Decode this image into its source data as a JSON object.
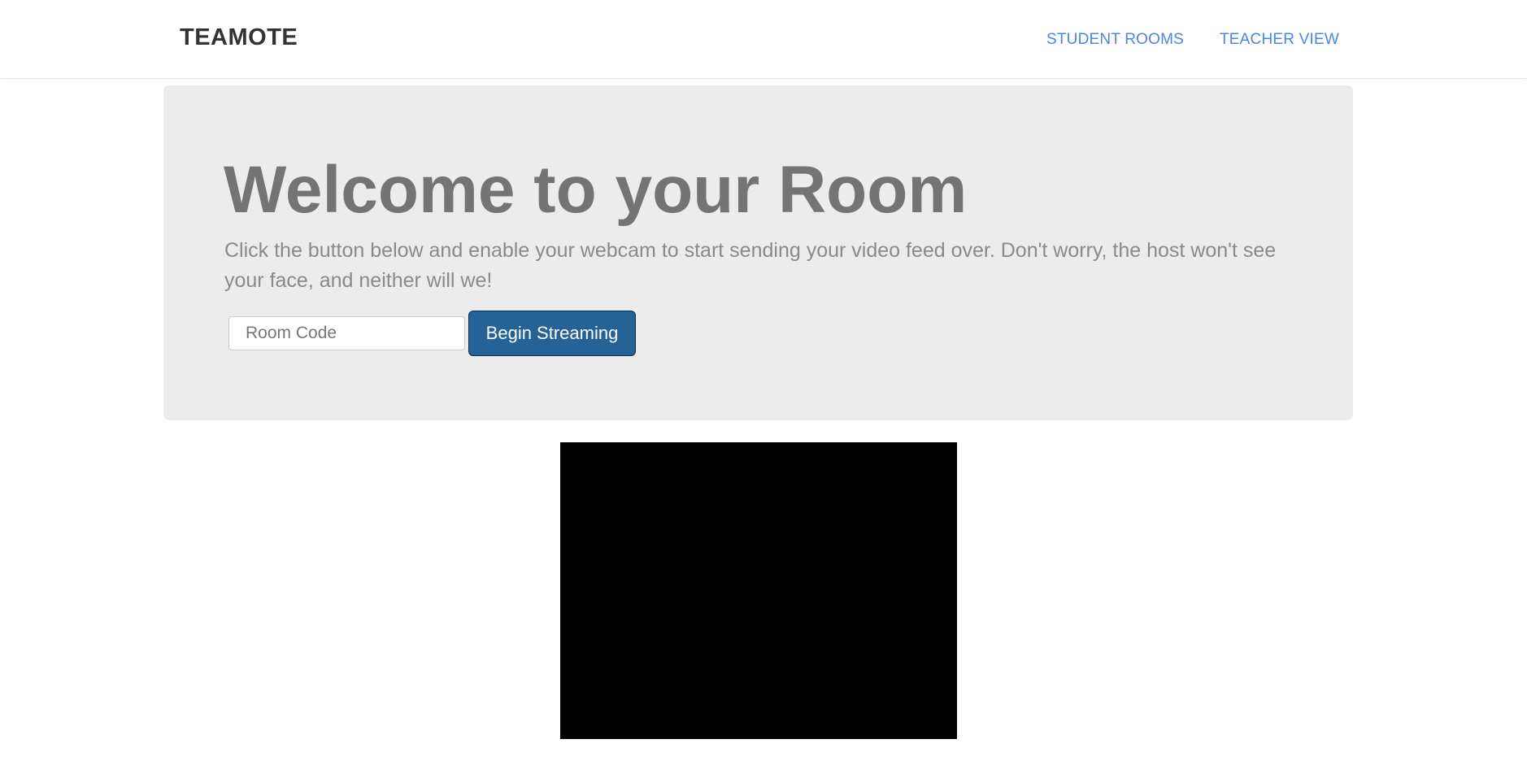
{
  "nav": {
    "brand": "TEAMOTE",
    "links": [
      {
        "label": "STUDENT ROOMS"
      },
      {
        "label": "TEACHER VIEW"
      }
    ],
    "link_color": "#4a86e8"
  },
  "hero": {
    "title": "Welcome to your Room",
    "description": "Click the button below and enable your webcam to start sending your video feed over. Don't worry, the host won't see your face, and neither will we!",
    "room_code_placeholder": "Room Code",
    "room_code_value": "",
    "begin_button_label": "Begin Streaming",
    "button_color": "#256296",
    "background_color": "#ececec"
  },
  "video": {
    "background_color": "#000000"
  }
}
